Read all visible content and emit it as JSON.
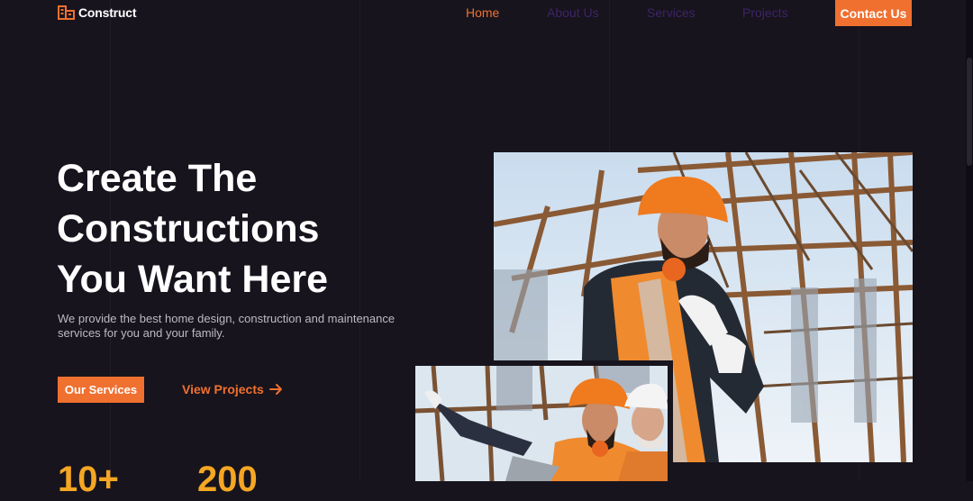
{
  "header": {
    "logo_text": "Construct",
    "nav": {
      "home": "Home",
      "about": "About Us",
      "services": "Services",
      "projects": "Projects"
    },
    "contact_label": "Contact Us"
  },
  "hero": {
    "title_lines": [
      "Create The",
      "Constructions",
      "You Want Here"
    ],
    "description": "We provide the best home design, construction and maintenance services for you and your family.",
    "primary_button": "Our Services",
    "secondary_link": "View Projects",
    "stats": [
      "10+",
      "200"
    ]
  },
  "images": {
    "main_alt": "Construction worker in orange hard hat on site",
    "small_alt": "Workers with hard hats pointing at structure"
  },
  "colors": {
    "background": "#17141d",
    "accent": "#f07030",
    "stat": "#f5a623",
    "nav_inactive": "#3d2466"
  },
  "icons": {
    "logo": "building-icon",
    "arrow": "arrow-right-icon"
  }
}
